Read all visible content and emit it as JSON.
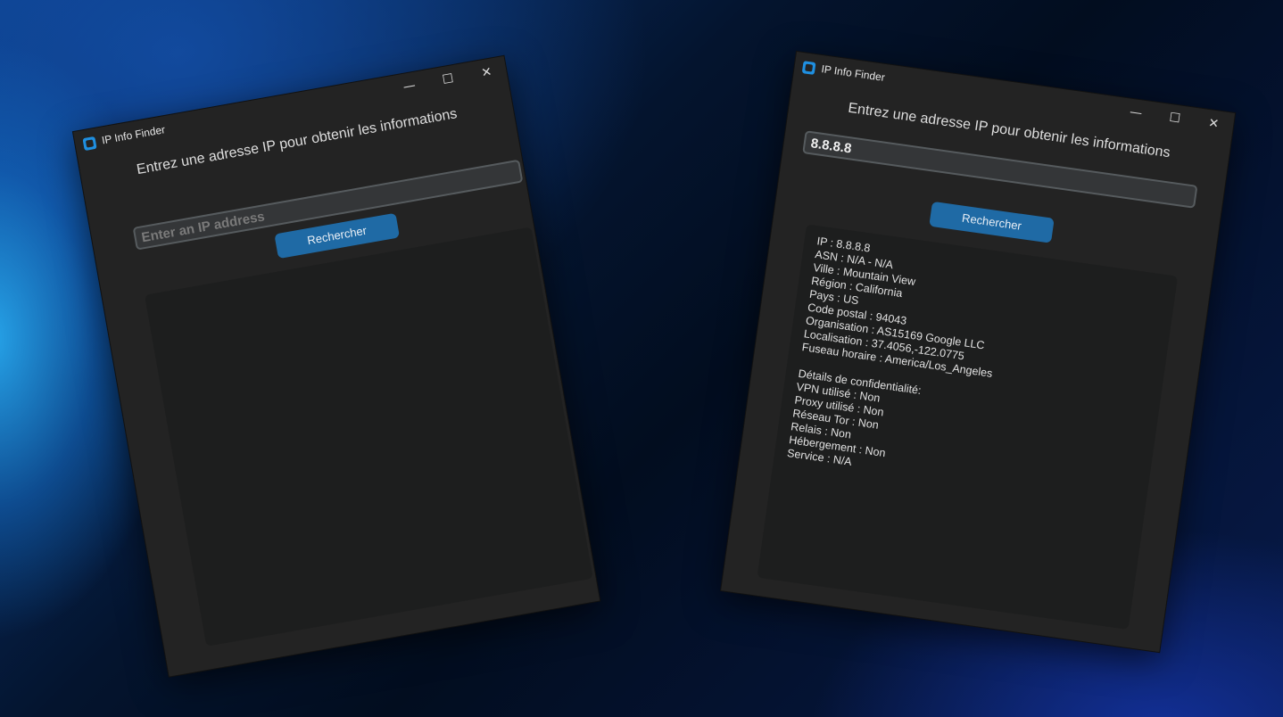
{
  "window_left": {
    "title": "IP Info Finder",
    "controls": {
      "minimize": "—",
      "maximize": "☐",
      "close": "✕"
    },
    "prompt": "Entrez une adresse IP pour obtenir les informations",
    "input": {
      "value": "",
      "placeholder": "Enter an IP address"
    },
    "search_button": "Rechercher"
  },
  "window_right": {
    "title": "IP Info Finder",
    "controls": {
      "minimize": "—",
      "maximize": "☐",
      "close": "✕"
    },
    "prompt": "Entrez une adresse IP pour obtenir les informations",
    "input": {
      "value": "8.8.8.8",
      "placeholder": "Enter an IP address"
    },
    "search_button": "Rechercher",
    "results": {
      "ip": "IP : 8.8.8.8",
      "asn": "ASN : N/A - N/A",
      "ville": "Ville : Mountain View",
      "region": "Région : California",
      "pays": "Pays : US",
      "code_postal": "Code postal : 94043",
      "organisation": "Organisation : AS15169 Google LLC",
      "localisation": "Localisation : 37.4056,-122.0775",
      "fuseau": "Fuseau horaire : America/Los_Angeles",
      "privacy_header": "Détails de confidentialité:",
      "vpn": "VPN utilisé : Non",
      "proxy": "Proxy utilisé : Non",
      "tor": "Réseau Tor : Non",
      "relais": "Relais : Non",
      "hebergement": "Hébergement : Non",
      "service": "Service : N/A"
    }
  }
}
